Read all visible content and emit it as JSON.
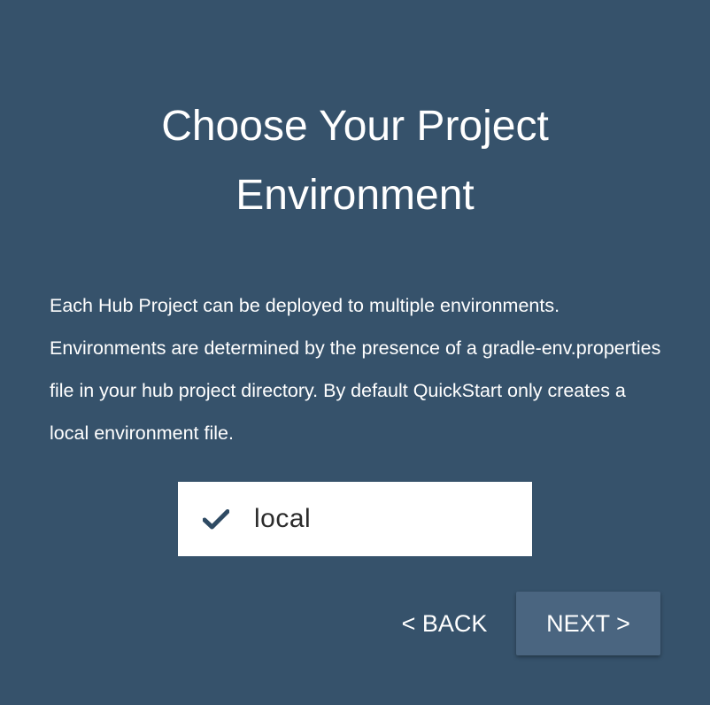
{
  "title_line1": "Choose Your Project",
  "title_line2": "Environment",
  "description": "Each Hub Project can be deployed to multiple environments. Environments are determined by the presence of a gradle-env.properties file in your hub project directory. By default QuickStart only creates a local environment file.",
  "environments": [
    {
      "label": "local",
      "selected": true,
      "icon": "check-icon"
    }
  ],
  "buttons": {
    "back": "< BACK",
    "next": "NEXT >"
  },
  "colors": {
    "background": "#36526b",
    "next_button": "#4a6580",
    "check": "#2e4a63"
  }
}
